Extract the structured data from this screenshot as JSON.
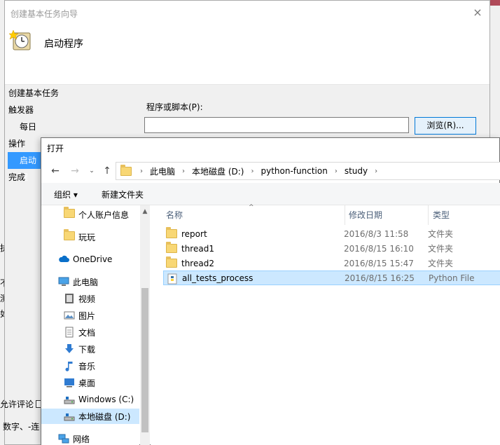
{
  "wizard": {
    "title": "创建基本任务向导",
    "close_glyph": "×",
    "heading": "启动程序",
    "nav": [
      {
        "label": "创建基本任务",
        "level": 0,
        "selected": false
      },
      {
        "label": "触发器",
        "level": 0,
        "selected": false
      },
      {
        "label": "每日",
        "level": 1,
        "selected": false
      },
      {
        "label": "操作",
        "level": 0,
        "selected": false
      },
      {
        "label": "启动程",
        "level": 1,
        "selected": true
      },
      {
        "label": "完成",
        "level": 0,
        "selected": false
      }
    ],
    "program_label": "程序或脚本(P):",
    "program_value": "",
    "browse_label": "浏览(R)..."
  },
  "background": {
    "frag_ban": "执",
    "frag_bu": "不",
    "frag_ce": "测",
    "frag_ru": "如",
    "frag_allow_comment": "允许评论",
    "frag_bottom": "数字、-连"
  },
  "dialog": {
    "title": "打开",
    "breadcrumbs": [
      "此电脑",
      "本地磁盘 (D:)",
      "python-function",
      "study"
    ],
    "toolbar": {
      "organize": "组织 ▾",
      "new_folder": "新建文件夹"
    },
    "nav_items": [
      {
        "label": "个人账户信息",
        "icon": "folder-icon",
        "indent": 1,
        "selected": false
      },
      {
        "label": "玩玩",
        "icon": "folder-icon",
        "indent": 1,
        "selected": false
      },
      {
        "label": "OneDrive",
        "icon": "cloud-icon",
        "indent": 0,
        "selected": false
      },
      {
        "label": "此电脑",
        "icon": "computer-icon",
        "indent": 0,
        "selected": false
      },
      {
        "label": "视频",
        "icon": "video-icon",
        "indent": 1,
        "selected": false
      },
      {
        "label": "图片",
        "icon": "picture-icon",
        "indent": 1,
        "selected": false
      },
      {
        "label": "文档",
        "icon": "document-icon",
        "indent": 1,
        "selected": false
      },
      {
        "label": "下载",
        "icon": "download-icon",
        "indent": 1,
        "selected": false
      },
      {
        "label": "音乐",
        "icon": "music-icon",
        "indent": 1,
        "selected": false
      },
      {
        "label": "桌面",
        "icon": "desktop-icon",
        "indent": 1,
        "selected": false
      },
      {
        "label": "Windows (C:)",
        "icon": "drive-icon",
        "indent": 1,
        "selected": false
      },
      {
        "label": "本地磁盘 (D:)",
        "icon": "drive-icon",
        "indent": 1,
        "selected": true
      },
      {
        "label": "网络",
        "icon": "network-icon",
        "indent": 0,
        "selected": false
      }
    ],
    "columns": {
      "name": "名称",
      "date": "修改日期",
      "type": "类型"
    },
    "files": [
      {
        "name": "report",
        "date": "2016/8/3 11:58",
        "type": "文件夹",
        "icon": "folder-icon",
        "selected": false
      },
      {
        "name": "thread1",
        "date": "2016/8/15 16:10",
        "type": "文件夹",
        "icon": "folder-icon",
        "selected": false
      },
      {
        "name": "thread2",
        "date": "2016/8/15 15:47",
        "type": "文件夹",
        "icon": "folder-icon",
        "selected": false
      },
      {
        "name": "all_tests_process",
        "date": "2016/8/15 16:25",
        "type": "Python File",
        "icon": "python-file-icon",
        "selected": true
      }
    ]
  }
}
